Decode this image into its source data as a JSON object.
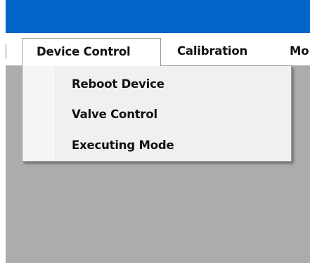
{
  "menubar": {
    "items": [
      {
        "label": "Device Control"
      },
      {
        "label": "Calibration"
      },
      {
        "label": "Mo"
      }
    ]
  },
  "device_control_menu": {
    "items": [
      {
        "label": "Reboot Device"
      },
      {
        "label": "Valve Control"
      },
      {
        "label": "Executing Mode"
      }
    ]
  },
  "colors": {
    "titlebar": "#0064c8",
    "content_background": "#acacac",
    "menu_background": "#f0f0f0"
  }
}
